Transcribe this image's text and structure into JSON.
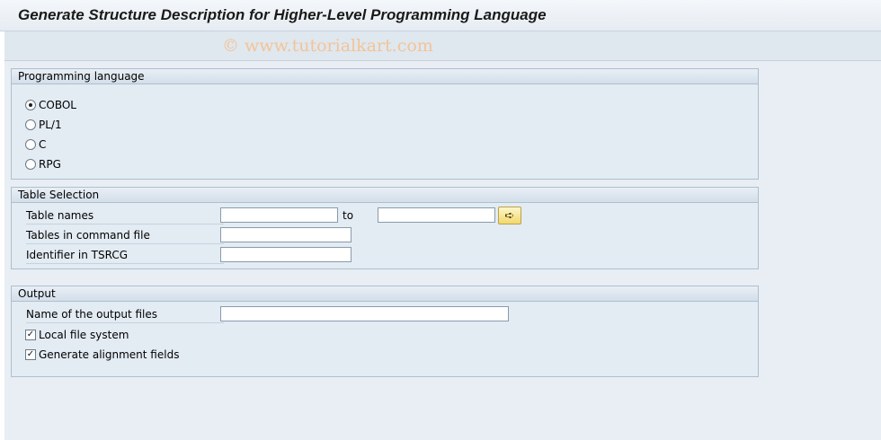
{
  "window": {
    "title": "Generate Structure Description for Higher-Level Programming Language",
    "watermark": "© www.tutorialkart.com"
  },
  "programming_language": {
    "header": "Programming language",
    "options": [
      {
        "label": "COBOL",
        "selected": true
      },
      {
        "label": "PL/1",
        "selected": false
      },
      {
        "label": "C",
        "selected": false
      },
      {
        "label": "RPG",
        "selected": false
      }
    ]
  },
  "table_selection": {
    "header": "Table Selection",
    "table_names_label": "Table names",
    "to_label": "to",
    "table_names_from": "",
    "table_names_to": "",
    "tables_in_command_file_label": "Tables in command file",
    "tables_in_command_file": "",
    "identifier_label": "Identifier in TSRCG",
    "identifier": "",
    "multiple_selection_icon": "arrow-right-icon"
  },
  "output": {
    "header": "Output",
    "output_files_label": "Name of the output files",
    "output_files": "",
    "local_file_system_label": "Local file system",
    "local_file_system_checked": true,
    "generate_alignment_label": "Generate alignment fields",
    "generate_alignment_checked": true
  }
}
